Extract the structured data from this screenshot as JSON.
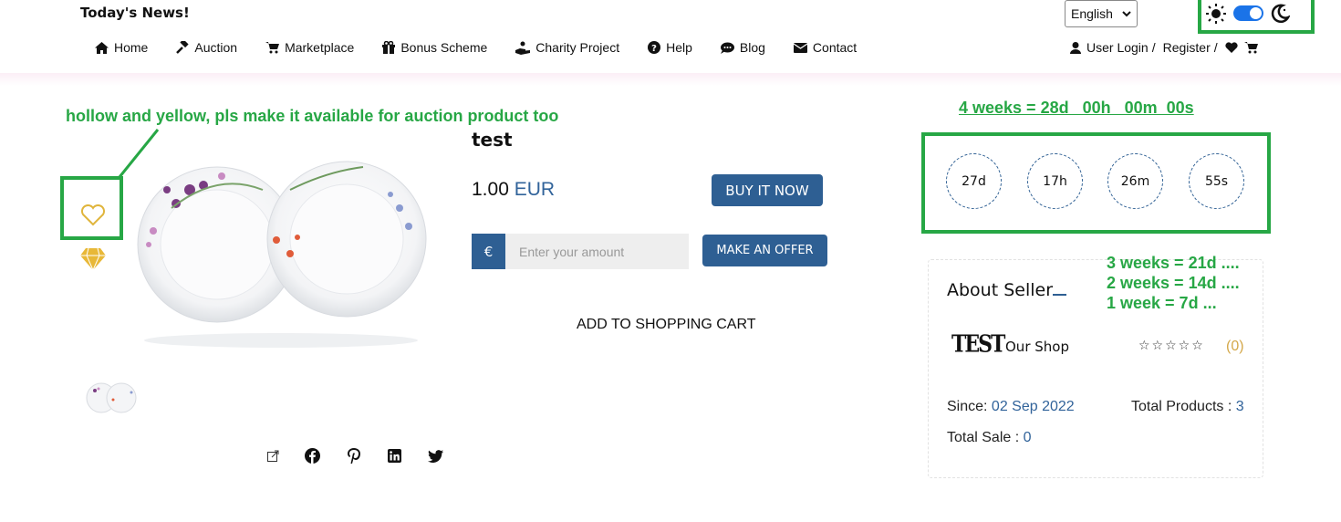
{
  "header": {
    "site_title": "Today's News!",
    "language": "English",
    "nav": [
      {
        "label": "Home",
        "icon": "home-icon"
      },
      {
        "label": "Auction",
        "icon": "gavel-icon"
      },
      {
        "label": "Marketplace",
        "icon": "cart-icon"
      },
      {
        "label": "Bonus Scheme",
        "icon": "gift-icon"
      },
      {
        "label": "Charity Project",
        "icon": "charity-hand-icon"
      },
      {
        "label": "Help",
        "icon": "question-icon"
      },
      {
        "label": "Blog",
        "icon": "chat-icon"
      },
      {
        "label": "Contact",
        "icon": "envelope-icon"
      }
    ],
    "user_login": "User Login",
    "register": "Register",
    "separator": "/"
  },
  "annotations": {
    "wishlist_note": "hollow and  yellow, pls make it available for auction product too",
    "countdown_note": "4 weeks = 28d   00h   00m  00s",
    "weeks_3": "3 weeks = 21d ....",
    "weeks_2": "2 weeks = 14d ....",
    "weeks_1": "1 week = 7d ..."
  },
  "product": {
    "title": "test",
    "price": "1.00",
    "currency": "EUR",
    "buy_now": "BUY IT NOW",
    "euro_symbol": "€",
    "amount_placeholder": "Enter your amount",
    "make_offer": "MAKE AN OFFER",
    "add_to_cart": "ADD TO SHOPPING CART"
  },
  "countdown": {
    "days": "27d",
    "hours": "17h",
    "minutes": "26m",
    "seconds": "55s"
  },
  "seller": {
    "heading": "About Seller",
    "logo_text": "TEST",
    "shop_name": "Our Shop",
    "stars": "☆☆☆☆☆",
    "rating_count": "(0)",
    "since_label": "Since:",
    "since_value": "02 Sep 2022",
    "total_products_label": "Total Products :",
    "total_products_value": "3",
    "total_sale_label": "Total Sale :",
    "total_sale_value": "0"
  },
  "colors": {
    "accent_blue": "#2e5f93",
    "annotation_green": "#27a745",
    "wishlist_yellow": "#e0b53c"
  }
}
